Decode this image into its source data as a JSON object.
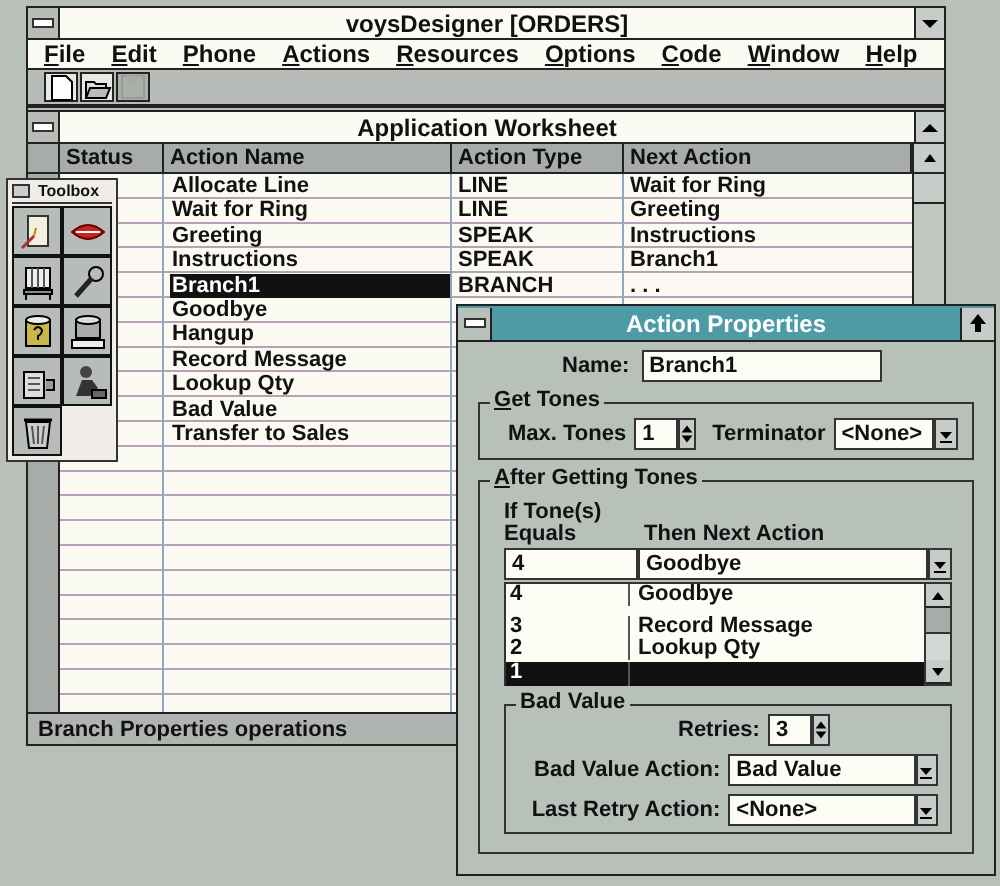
{
  "window": {
    "title": "voysDesigner [ORDERS]"
  },
  "menu": [
    {
      "label": "File"
    },
    {
      "label": "Edit"
    },
    {
      "label": "Phone"
    },
    {
      "label": "Actions"
    },
    {
      "label": "Resources"
    },
    {
      "label": "Options"
    },
    {
      "label": "Code"
    },
    {
      "label": "Window"
    },
    {
      "label": "Help"
    }
  ],
  "toolbar": [
    {
      "kind": "new",
      "disabled": false
    },
    {
      "kind": "open",
      "disabled": false
    },
    {
      "kind": "save",
      "disabled": true
    }
  ],
  "worksheet": {
    "title": "Application Worksheet",
    "columns": [
      "Status",
      "Action Name",
      "Action Type",
      "Next Action"
    ],
    "rows": [
      {
        "name": "Allocate Line",
        "type": "LINE",
        "next": "Wait for Ring",
        "selected": false
      },
      {
        "name": "Wait for Ring",
        "type": "LINE",
        "next": "Greeting",
        "selected": false
      },
      {
        "name": "Greeting",
        "type": "SPEAK",
        "next": "Instructions",
        "selected": false
      },
      {
        "name": "Instructions",
        "type": "SPEAK",
        "next": "Branch1",
        "selected": false
      },
      {
        "name": "Branch1",
        "type": "BRANCH",
        "next": ". . .",
        "selected": true
      },
      {
        "name": "Goodbye",
        "selected": false
      },
      {
        "name": "Hangup",
        "selected": false
      },
      {
        "name": "Record Message",
        "selected": false
      },
      {
        "name": "Lookup Qty",
        "selected": false
      },
      {
        "name": "Bad Value",
        "selected": false
      },
      {
        "name": "Transfer to Sales",
        "selected": false
      }
    ],
    "status_bar": "Branch Properties operations"
  },
  "toolbox": {
    "title": "Toolbox",
    "tools": [
      {
        "kind": "form"
      },
      {
        "kind": "lips"
      },
      {
        "kind": "switch"
      },
      {
        "kind": "microphone"
      },
      {
        "kind": "query"
      },
      {
        "kind": "drum"
      },
      {
        "kind": "exchange"
      },
      {
        "kind": "operator"
      },
      {
        "kind": "trash"
      }
    ]
  },
  "dialog": {
    "title": "Action Properties",
    "name_label": "Name:",
    "name_value": "Branch1",
    "get_tones": {
      "label": "Get Tones",
      "max_label": "Max. Tones",
      "max_value": "1",
      "terminator_label": "Terminator",
      "terminator_value": "<None>"
    },
    "after": {
      "label": "After Getting Tones",
      "col1": [
        "If Tone(s)",
        "Equals"
      ],
      "col2": "Then Next  Action",
      "edit": {
        "tone": "4",
        "next": "Goodbye"
      },
      "rows": [
        {
          "tone": "4",
          "next": "Goodbye",
          "selected": false
        },
        {
          "tone": "3",
          "next": "Record Message",
          "selected": false
        },
        {
          "tone": "2",
          "next": "Lookup Qty",
          "selected": false
        },
        {
          "tone": "1",
          "selected": true
        }
      ]
    },
    "bad_value": {
      "label": "Bad Value",
      "retries_label": "Retries:",
      "retries_value": "3",
      "action_label": "Bad Value Action:",
      "action_value": "Bad Value",
      "last_label": "Last Retry Action:",
      "last_value": "<None>"
    }
  }
}
